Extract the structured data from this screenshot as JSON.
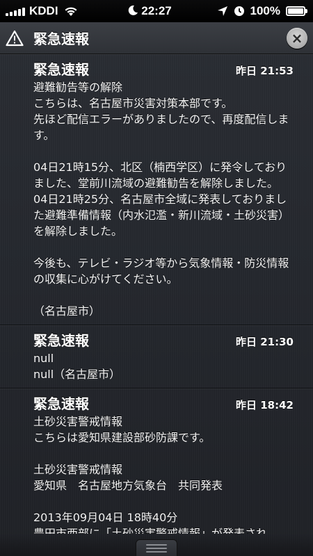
{
  "status_bar": {
    "carrier": "KDDI",
    "time": "22:27",
    "battery": "100%",
    "signal_bars": 5,
    "battery_level": 1.0
  },
  "header": {
    "title": "緊急速報",
    "icon": "warning-triangle-icon",
    "close_icon": "close-icon"
  },
  "notifications": [
    {
      "title": "緊急速報",
      "time": "昨日 21:53",
      "body": "避難勧告等の解除\nこちらは、名古屋市災害対策本部です。\n先ほど配信エラーがありましたので、再度配信します。\n\n04日21時15分、北区（楠西学区）に発令しておりました、堂前川流域の避難勧告を解除しました。\n04日21時25分、名古屋市全域に発表しておりました避難準備情報（内水氾濫・新川流域・土砂災害）を解除しました。\n\n今後も、テレビ・ラジオ等から気象情報・防災情報の収集に心がけてください。\n\n（名古屋市）"
    },
    {
      "title": "緊急速報",
      "time": "昨日 21:30",
      "body": "null\nnull（名古屋市）"
    },
    {
      "title": "緊急速報",
      "time": "昨日 18:42",
      "body": "土砂災害警戒情報\nこちらは愛知県建設部砂防課です。\n\n土砂災害警戒情報\n愛知県　名古屋地方気象台　共同発表\n\n2013年09月04日 18時40分\n豊田市西部に「土砂災害警戒情報」が発表され"
    }
  ]
}
